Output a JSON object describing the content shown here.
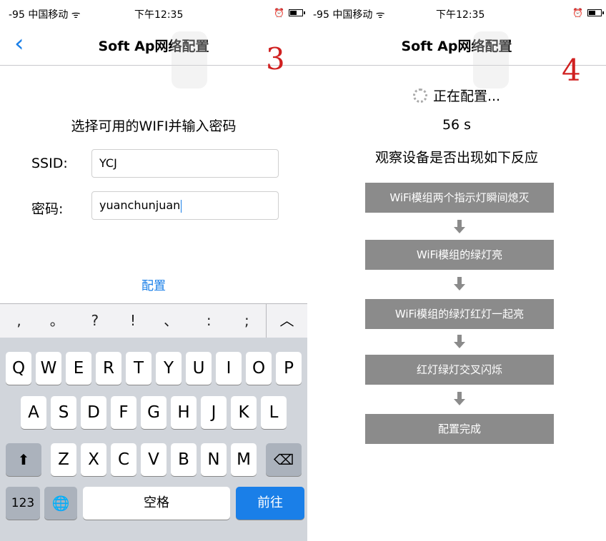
{
  "left": {
    "status": {
      "signal": "-95 中国移动 ᯤ",
      "time": "下午12:35"
    },
    "nav": {
      "back": "‹",
      "title": "Soft Ap网络配置"
    },
    "annotation": "3",
    "prompt": "选择可用的WIFI并输入密码",
    "ssid": {
      "label": "SSID:",
      "value": "YCJ"
    },
    "password": {
      "label": "密码:",
      "value": "yuanchunjuan"
    },
    "config_label": "配置",
    "keyboard": {
      "punct": [
        ",",
        "。",
        "?",
        "!",
        "、",
        ":",
        ";"
      ],
      "collapse": "︿",
      "row1": [
        "Q",
        "W",
        "E",
        "R",
        "T",
        "Y",
        "U",
        "I",
        "O",
        "P"
      ],
      "row2": [
        "A",
        "S",
        "D",
        "F",
        "G",
        "H",
        "J",
        "K",
        "L"
      ],
      "row3": [
        "Z",
        "X",
        "C",
        "V",
        "B",
        "N",
        "M"
      ],
      "shift": "⬆",
      "delete": "⌫",
      "num": "123",
      "globe": "🌐",
      "space": "空格",
      "go": "前往"
    }
  },
  "right": {
    "status": {
      "signal": "-95 中国移动 ᯤ",
      "time": "下午12:35"
    },
    "nav": {
      "title": "Soft Ap网络配置"
    },
    "annotation": "4",
    "configuring": "正在配置...",
    "countdown": "56 s",
    "observe": "观察设备是否出现如下反应",
    "steps": [
      "WiFi模组两个指示灯瞬间熄灭",
      "WiFi模组的绿灯亮",
      "WiFi模组的绿灯红灯一起亮",
      "红灯绿灯交叉闪烁",
      "配置完成"
    ]
  },
  "colors": {
    "accent": "#1a7fe8",
    "step_bg": "#8b8b8b",
    "annotation": "#d02020"
  },
  "icons": [
    "back-chevron-icon",
    "wifi-icon",
    "alarm-icon",
    "battery-icon",
    "spinner-icon",
    "shift-icon",
    "delete-icon",
    "globe-icon",
    "collapse-icon",
    "down-arrow-icon"
  ]
}
